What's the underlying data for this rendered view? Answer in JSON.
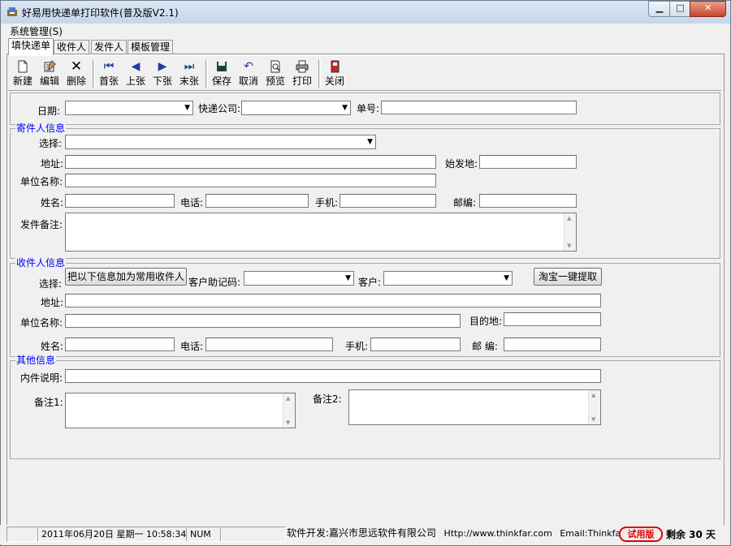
{
  "window": {
    "title": "好易用快递单打印软件(普及版V2.1)",
    "min_icon": "minimize-icon",
    "max_icon": "maximize-icon",
    "close_icon": "close-icon"
  },
  "menu": {
    "system": "系统管理(S)"
  },
  "tabs": [
    "填快递单",
    "收件人",
    "发件人",
    "模板管理"
  ],
  "toolbar": {
    "new": "新建",
    "edit": "编辑",
    "delete": "删除",
    "first": "首张",
    "prev": "上张",
    "next": "下张",
    "last": "末张",
    "save": "保存",
    "cancel": "取消",
    "preview": "预览",
    "print": "打印",
    "close": "关闭"
  },
  "top": {
    "date_label": "日期:",
    "courier_label": "快递公司:",
    "order_label": "单号:"
  },
  "sender": {
    "legend": "寄件人信息",
    "select_label": "选择:",
    "address_label": "地址:",
    "origin_label": "始发地:",
    "company_label": "单位名称:",
    "name_label": "姓名:",
    "phone_label": "电话:",
    "mobile_label": "手机:",
    "zip_label": "邮编:",
    "remark_label": "发件备注:"
  },
  "receiver": {
    "legend": "收件人信息",
    "select_label": "选择:",
    "add_common_button": "把以下信息加为常用收件人",
    "mnemonic_label": "客户助记码:",
    "customer_label": "客户:",
    "taobao_button": "淘宝一键提取",
    "address_label": "地址:",
    "company_label": "单位名称:",
    "dest_label": "目的地:",
    "name_label": "姓名:",
    "phone_label": "电话:",
    "mobile_label": "手机:",
    "zip_label": "邮 编:"
  },
  "other": {
    "legend": "其他信息",
    "contents_label": "内件说明:",
    "note1_label": "备注1:",
    "note2_label": "备注2:"
  },
  "status": {
    "datetime": "2011年06月20日 星期一 10:58:34",
    "num": "NUM",
    "developer": "软件开发:嘉兴市思远软件有限公司",
    "url": "Http://www.thinkfar.com",
    "email": "Email:Thinkfar@ya",
    "trial": "试用版",
    "remaining": "剩余 30 天"
  }
}
